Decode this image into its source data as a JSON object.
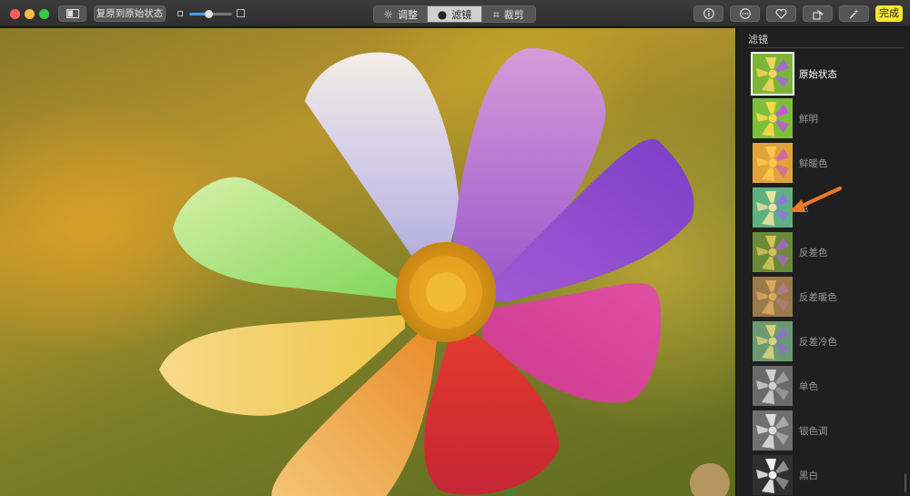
{
  "window": {
    "traffic_lights": [
      "close",
      "minimize",
      "zoom"
    ]
  },
  "toolbar": {
    "split_view_icon": "split-view-icon",
    "revert_label": "复原到原始状态",
    "zoom_slider_value": 0.45,
    "segments": [
      {
        "label": "调整",
        "icon": "adjust-icon",
        "active": false
      },
      {
        "label": "滤镜",
        "icon": "filter-icon",
        "active": true
      },
      {
        "label": "裁剪",
        "icon": "crop-icon",
        "active": false
      }
    ],
    "icons": [
      "info-icon",
      "more-icon",
      "heart-icon",
      "rotate-icon",
      "magic-wand-icon"
    ],
    "done_label": "完成"
  },
  "sidebar": {
    "title": "滤镜",
    "filters": [
      {
        "label": "原始状态",
        "selected": true,
        "tone": "original"
      },
      {
        "label": "鲜明",
        "selected": false,
        "tone": "vivid"
      },
      {
        "label": "鲜暖色",
        "selected": false,
        "tone": "vivid-warm"
      },
      {
        "label": "色",
        "selected": false,
        "tone": "vivid-cool"
      },
      {
        "label": "反差色",
        "selected": false,
        "tone": "dramatic"
      },
      {
        "label": "反差暖色",
        "selected": false,
        "tone": "dramatic-warm"
      },
      {
        "label": "反差冷色",
        "selected": false,
        "tone": "dramatic-cool"
      },
      {
        "label": "单色",
        "selected": false,
        "tone": "mono"
      },
      {
        "label": "银色调",
        "selected": false,
        "tone": "silvertone"
      },
      {
        "label": "黑白",
        "selected": false,
        "tone": "noir"
      }
    ]
  },
  "colors": {
    "accent_done": "#f7e633",
    "selection_outline": "#ffffff",
    "arrow": "#f07a24"
  }
}
